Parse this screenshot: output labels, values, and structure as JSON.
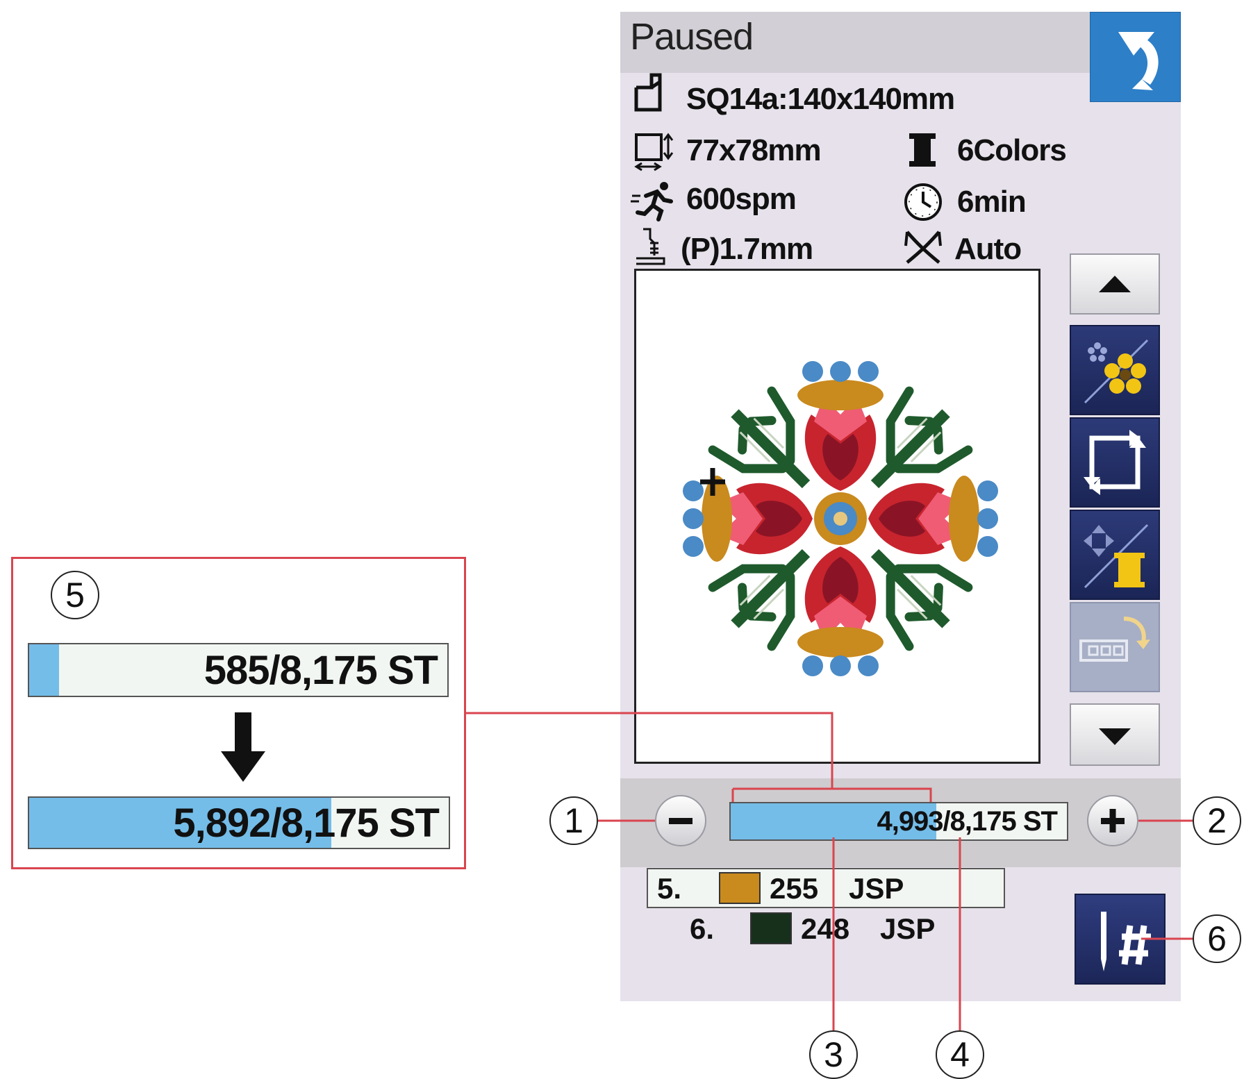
{
  "status": "Paused",
  "hoop": "SQ14a:140x140mm",
  "design_size": "77x78mm",
  "colors": "6Colors",
  "speed": "600spm",
  "time": "6min",
  "stitch_length": "(P)1.7mm",
  "thread_cut": "Auto",
  "progress": {
    "label": "4,993/8,175 ST",
    "current": 4993,
    "total": 8175
  },
  "callout_example": {
    "before_label": "585/8,175 ST",
    "before_current": 585,
    "after_label": "5,892/8,175 ST",
    "after_current": 5892,
    "total": 8175
  },
  "threads": [
    {
      "index": "5.",
      "code": "255",
      "brand": "JSP",
      "color": "#c98a1e",
      "current": true
    },
    {
      "index": "6.",
      "code": "248",
      "brand": "JSP",
      "color": "#17301c",
      "current": false
    }
  ],
  "callout_numbers": [
    "1",
    "2",
    "3",
    "4",
    "5",
    "6"
  ],
  "icons": {
    "back": "return-arrow-icon",
    "hoop": "hoop-icon",
    "size": "design-size-icon",
    "spool": "thread-spool-icon",
    "speed": "running-speed-icon",
    "clock": "clock-icon",
    "foot": "presser-foot-icon",
    "cutter": "thread-cutter-icon"
  },
  "palette": {
    "progress_fill": "#74bde9",
    "callout_line": "#d9454f",
    "button_navy": "#1f2a5e",
    "back_blue": "#2d7fc8"
  }
}
